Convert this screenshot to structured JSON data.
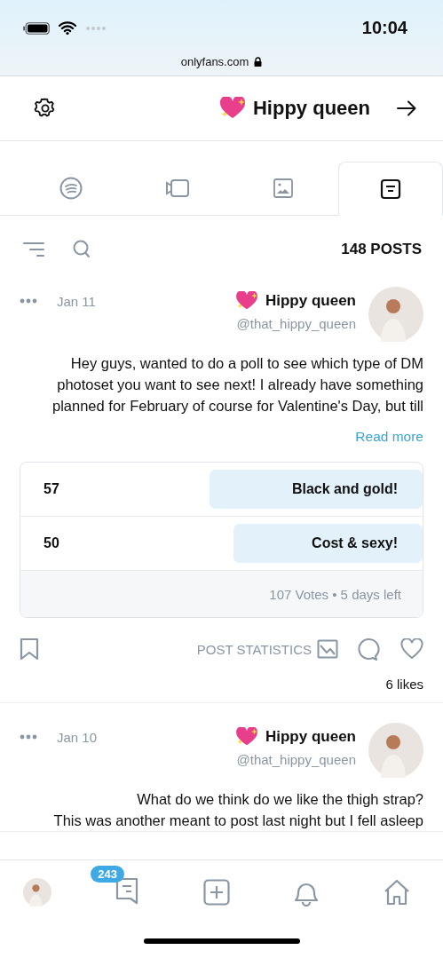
{
  "status_bar": {
    "time": "10:04",
    "url": "onlyfans.com"
  },
  "header": {
    "title": "Hippy queen"
  },
  "tabs": [
    {
      "kind": "posts",
      "selected": true
    },
    {
      "kind": "photos",
      "selected": false
    },
    {
      "kind": "videos",
      "selected": false
    },
    {
      "kind": "audio",
      "selected": false
    }
  ],
  "posts_count": "148 POSTS",
  "posts": [
    {
      "name": "Hippy queen",
      "handle": "@that_hippy_queen",
      "date": "Jan 11",
      "text": [
        "Hey guys, wanted to do a poll to see which type of DM photoset you want to see next! I already have something planned for February of course for Valentine's Day, but till"
      ],
      "read_more": "Read more",
      "poll": {
        "options": [
          {
            "label": "Black and gold!",
            "count": "57",
            "level": 0.53
          },
          {
            "label": "Cost & sexy!",
            "count": "50",
            "level": 0.47
          }
        ],
        "footer": "107 Votes • 5 days left"
      },
      "stats": "POST STATISTICS",
      "likes": "6 likes"
    },
    {
      "name": "Hippy queen",
      "handle": "@that_hippy_queen",
      "date": "Jan 10",
      "text": [
        "What do we think do we like the thigh strap?",
        "This was another meant to post last night but I fell asleep"
      ]
    }
  ],
  "nav": {
    "messages_badge": "243"
  }
}
